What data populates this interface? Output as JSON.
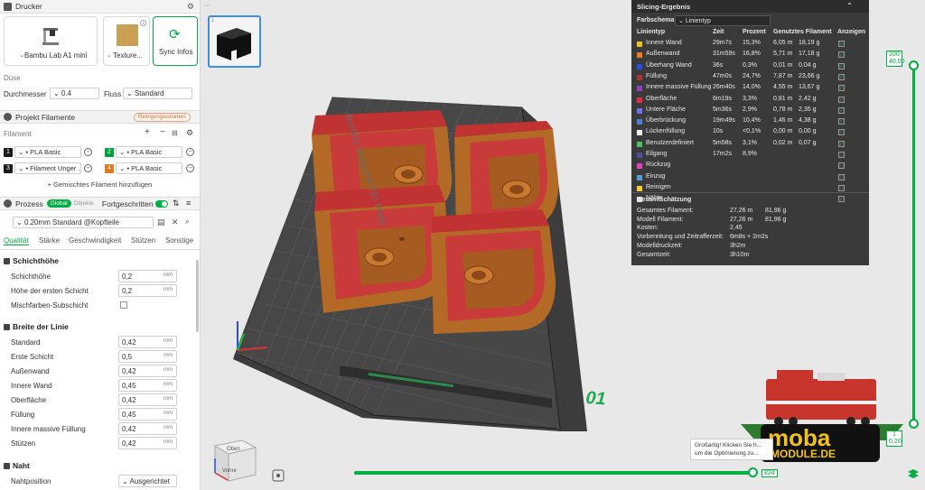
{
  "printer": {
    "section_title": "Drucker",
    "printer_name": "Bambu Lab A1 mini",
    "plate_name": "Texture...",
    "sync_label": "Sync Infos",
    "nozzle_label": "Düse",
    "diameter_label": "Durchmesser",
    "diameter_value": "0.4",
    "flow_label": "Fluss",
    "flow_value": "Standard"
  },
  "filaments": {
    "section_title": "Projekt Filamente",
    "clean_badge": "Reinigungsvolumen",
    "filament_label": "Filament",
    "add_mixed": "Gemischtes Filament hinzufügen",
    "items": [
      {
        "num": "1",
        "name": "PLA Basic",
        "color": "#1a1a1a"
      },
      {
        "num": "2",
        "name": "PLA Basic",
        "color": "#00a040"
      },
      {
        "num": "3",
        "name": "Filament Unger ...",
        "color": "#1a1a1a"
      },
      {
        "num": "4",
        "name": "PLA Basic",
        "color": "#e07a20"
      }
    ]
  },
  "process": {
    "section_title": "Prozess",
    "global_pill": "Global",
    "objects_pill": "Objekte",
    "advanced_label": "Fortgeschritten",
    "profile": "0.20mm Standard @Kopfteile",
    "tabs": [
      "Qualität",
      "Stärke",
      "Geschwindigkeit",
      "Stützen",
      "Sonstige"
    ],
    "layer_group": "Schichthöhe",
    "layer_rows": [
      {
        "label": "Schichthöhe",
        "value": "0,2",
        "unit": "mm"
      },
      {
        "label": "Höhe der ersten Schicht",
        "value": "0,2",
        "unit": "mm"
      }
    ],
    "mix_label": "Mischfarben-Subschicht",
    "width_group": "Breite der Linie",
    "width_rows": [
      {
        "label": "Standard",
        "value": "0,42",
        "unit": "mm"
      },
      {
        "label": "Erste Schicht",
        "value": "0,5",
        "unit": "mm"
      },
      {
        "label": "Außenwand",
        "value": "0,42",
        "unit": "mm"
      },
      {
        "label": "Innere Wand",
        "value": "0,45",
        "unit": "mm"
      },
      {
        "label": "Oberfläche",
        "value": "0,42",
        "unit": "mm"
      },
      {
        "label": "Füllung",
        "value": "0,45",
        "unit": "mm"
      },
      {
        "label": "Innere massive Füllung",
        "value": "0,42",
        "unit": "mm"
      },
      {
        "label": "Stützen",
        "value": "0,42",
        "unit": "mm"
      }
    ],
    "seam_group": "Naht",
    "seam_label": "Nahtposition",
    "seam_value": "Ausgerichtet"
  },
  "plate": {
    "thumb_index": "1",
    "plate_number": "01",
    "bed_text": "Bambu Textured PEI Plate",
    "cube_top": "Oben",
    "cube_front": "Vorne"
  },
  "results": {
    "title": "Slicing-Ergebnis",
    "scheme_label": "Farbschema",
    "scheme_value": "Linientyp",
    "headers": [
      "Linientyp",
      "Zeit",
      "Prozent",
      "Genutztes Filament",
      "Anzeigen"
    ],
    "rows": [
      {
        "name": "Innere Wand",
        "color": "#f0c020",
        "time": "29m7s",
        "pct": "15,3%",
        "len": "6,05 m",
        "g": "18,19 g",
        "show": true
      },
      {
        "name": "Außenwand",
        "color": "#f07820",
        "time": "31m59s",
        "pct": "16,8%",
        "len": "5,71 m",
        "g": "17,18 g",
        "show": true
      },
      {
        "name": "Überhang Wand",
        "color": "#2050e0",
        "time": "36s",
        "pct": "0,3%",
        "len": "0,01 m",
        "g": "0,04 g",
        "show": true
      },
      {
        "name": "Füllung",
        "color": "#b03030",
        "time": "47m0s",
        "pct": "24,7%",
        "len": "7,87 m",
        "g": "23,66 g",
        "show": true
      },
      {
        "name": "Innere massive Füllung",
        "color": "#9040c0",
        "time": "26m40s",
        "pct": "14,0%",
        "len": "4,55 m",
        "g": "13,67 g",
        "show": true
      },
      {
        "name": "Oberfläche",
        "color": "#e03040",
        "time": "6m19s",
        "pct": "3,3%",
        "len": "0,81 m",
        "g": "2,42 g",
        "show": true
      },
      {
        "name": "Untere Fläche",
        "color": "#7070f0",
        "time": "5m36s",
        "pct": "2,9%",
        "len": "0,78 m",
        "g": "2,35 g",
        "show": true
      },
      {
        "name": "Überbrückung",
        "color": "#5080d0",
        "time": "19m49s",
        "pct": "10,4%",
        "len": "1,46 m",
        "g": "4,38 g",
        "show": true
      },
      {
        "name": "Lückenfüllung",
        "color": "#f0f0f0",
        "time": "10s",
        "pct": "<0,1%",
        "len": "0,00 m",
        "g": "0,00 g",
        "show": true
      },
      {
        "name": "Benutzerdefiniert",
        "color": "#50c060",
        "time": "5m58s",
        "pct": "3,1%",
        "len": "0,02 m",
        "g": "0,07 g",
        "show": true
      },
      {
        "name": "Eilgang",
        "color": "#5050a0",
        "time": "17m2s",
        "pct": "8,9%",
        "len": "",
        "g": "",
        "show": false
      },
      {
        "name": "Rückzug",
        "color": "#e040c0",
        "time": "",
        "pct": "",
        "len": "",
        "g": "",
        "show": false
      },
      {
        "name": "Einzug",
        "color": "#50a0d0",
        "time": "",
        "pct": "",
        "len": "",
        "g": "",
        "show": false
      },
      {
        "name": "Reinigen",
        "color": "#f0d030",
        "time": "",
        "pct": "",
        "len": "",
        "g": "",
        "show": false
      },
      {
        "name": "Nähte",
        "color": "#e0e0e0",
        "time": "",
        "pct": "",
        "len": "",
        "g": "",
        "show": true
      }
    ],
    "estimate_title": "Gesamtschätzung",
    "estimates": [
      {
        "label": "Gesamtes Filament:",
        "v1": "27,26 m",
        "v2": "81,96 g"
      },
      {
        "label": "Modell Filament:",
        "v1": "27,26 m",
        "v2": "81,96 g"
      },
      {
        "label": "Kosten:",
        "v1": "2,45",
        "v2": ""
      },
      {
        "label": "Vorbereitung und Zeitrafferzeit:",
        "v1": "6m8s + 2m2s",
        "v2": ""
      },
      {
        "label": "Modelldruckzeit:",
        "v1": "3h2m",
        "v2": ""
      },
      {
        "label": "Gesamtzeit:",
        "v1": "3h10m",
        "v2": ""
      }
    ]
  },
  "sliders": {
    "top_layer": "200",
    "top_height": "40,00",
    "bottom_layer": "1",
    "bottom_height": "0,20",
    "h_value": "824"
  },
  "toast": {
    "text": "Großartig! Klicken Sie h... um die Optimierung zu..."
  },
  "watermark": {
    "line1": "moba",
    "line2": "MODULE.DE"
  }
}
